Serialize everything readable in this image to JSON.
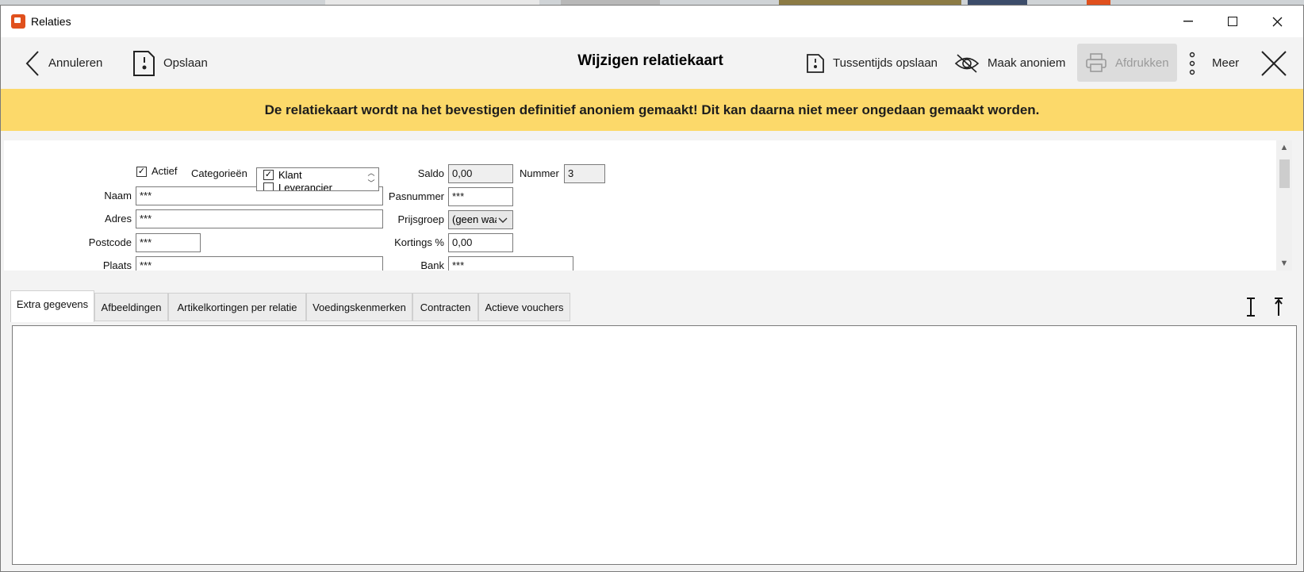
{
  "window": {
    "title": "Relaties"
  },
  "toolbar": {
    "cancel_label": "Annuleren",
    "save_label": "Opslaan",
    "title": "Wijzigen relatiekaart",
    "interim_save_label": "Tussentijds opslaan",
    "anonymize_label": "Maak anoniem",
    "print_label": "Afdrukken",
    "more_label": "Meer"
  },
  "banner": {
    "text": "De relatiekaart wordt na het bevestigen definitief anoniem gemaakt! Dit kan daarna niet meer ongedaan gemaakt worden."
  },
  "form": {
    "active_label": "Actief",
    "active_checked": true,
    "categories_label": "Categorieën",
    "categories": [
      {
        "label": "Klant",
        "checked": true
      },
      {
        "label": "Leverancier",
        "checked": false
      }
    ],
    "name_label": "Naam",
    "name_value": "***",
    "address_label": "Adres",
    "address_value": "***",
    "postcode_label": "Postcode",
    "postcode_value": "***",
    "city_label": "Plaats",
    "city_value": "***",
    "balance_label": "Saldo",
    "balance_value": "0,00",
    "number_label": "Nummer",
    "number_value": "3",
    "pass_label": "Pasnummer",
    "pass_value": "***",
    "price_group_label": "Prijsgroep",
    "price_group_value": "(geen waarde)",
    "discount_label": "Kortings %",
    "discount_value": "0,00",
    "bank_label": "Bank",
    "bank_value": "***"
  },
  "tabs": [
    {
      "label": "Extra gegevens",
      "active": true
    },
    {
      "label": "Afbeeldingen",
      "active": false
    },
    {
      "label": "Artikelkortingen per relatie",
      "active": false
    },
    {
      "label": "Voedingskenmerken",
      "active": false
    },
    {
      "label": "Contracten",
      "active": false
    },
    {
      "label": "Actieve vouchers",
      "active": false
    }
  ],
  "colors": {
    "banner": "#fcd96a",
    "app_accent": "#e0501d"
  },
  "icons": {
    "back": "chevron-left-icon",
    "save": "save-document-icon",
    "anonymize": "eye-off-icon",
    "print": "printer-icon",
    "more": "vertical-dots-icon",
    "close": "close-x-icon"
  }
}
